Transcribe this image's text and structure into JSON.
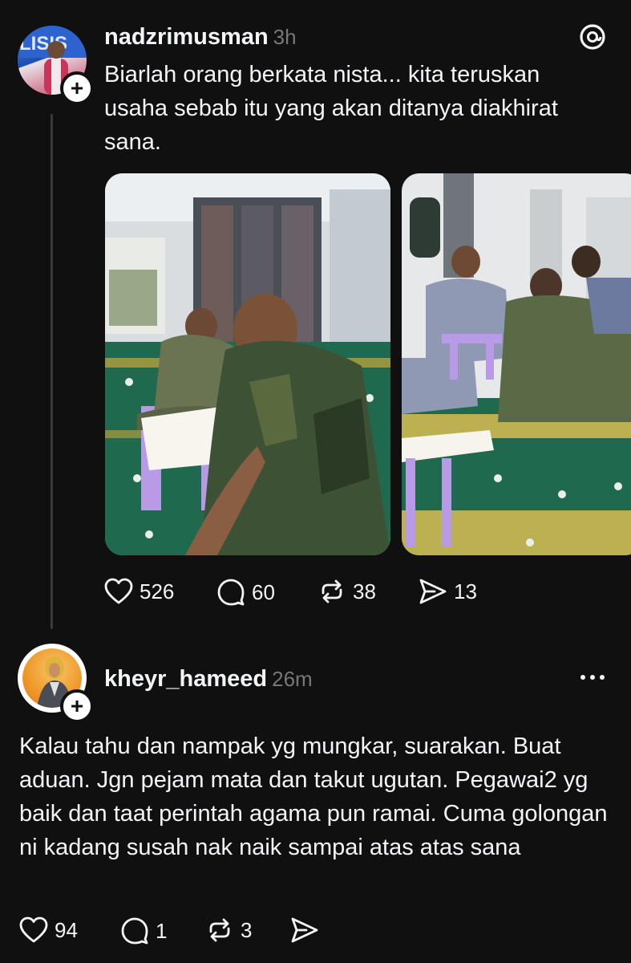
{
  "post": {
    "username": "nadzrimusman",
    "time": "3h",
    "text": "Biarlah orang berkata nista... kita teruskan usaha sebab itu yang akan ditanya diakhirat sana.",
    "avatar_label": "LISIS",
    "likes": "526",
    "comments": "60",
    "reposts": "38",
    "shares": "13",
    "images": [
      "photo-men-reading-quran",
      "photo-group-reading"
    ]
  },
  "reply": {
    "username": "kheyr_hameed",
    "time": "26m",
    "text": "Kalau tahu dan nampak yg mungkar, suarakan. Buat aduan. Jgn pejam mata dan takut ugutan. Pegawai2 yg baik dan taat perintah agama pun ramai. Cuma golongan ni kadang susah nak naik sampai atas atas sana",
    "likes": "94",
    "comments": "1",
    "reposts": "3"
  },
  "icons": {
    "app_logo": "threads-logo-icon",
    "more": "more-icon",
    "follow": "plus-icon",
    "like": "heart-icon",
    "comment": "comment-icon",
    "repost": "repost-icon",
    "share": "send-icon"
  },
  "colors": {
    "background": "#101010",
    "text": "#f3f5f7",
    "muted": "#777777",
    "line": "#3a3a3a"
  }
}
